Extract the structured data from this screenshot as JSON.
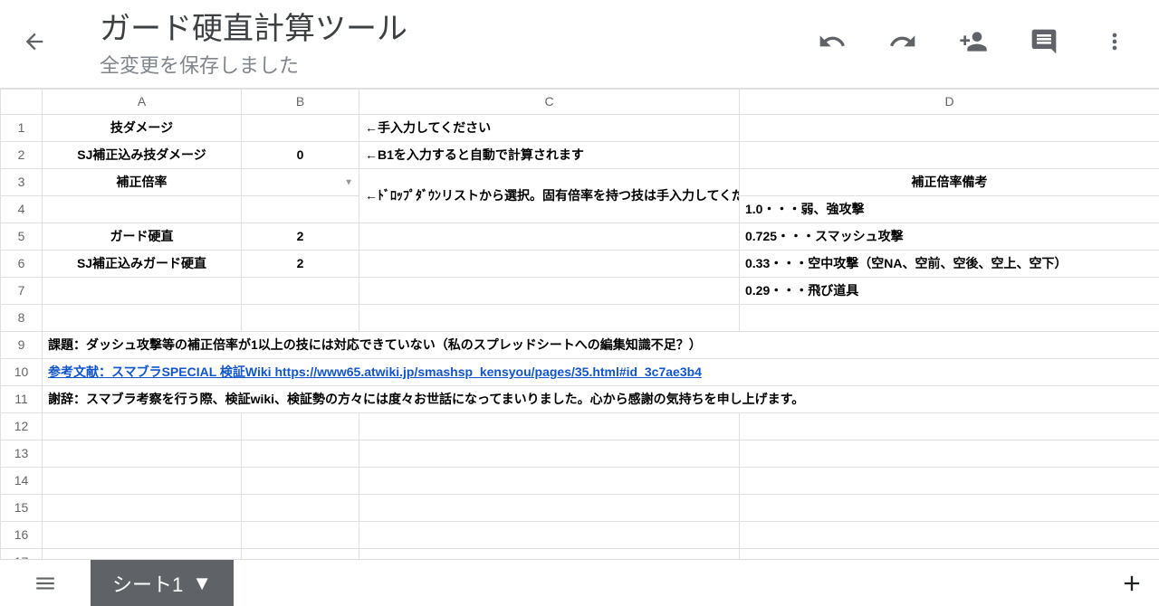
{
  "header": {
    "title": "ガード硬直計算ツール",
    "save_status": "全変更を保存しました"
  },
  "columns": [
    "A",
    "B",
    "C",
    "D"
  ],
  "cells": {
    "A1": "技ダメージ",
    "C1": "←手入力してください",
    "A2": "SJ補正込み技ダメージ",
    "B2": "0",
    "C2": "←B1を入力すると自動で計算されます",
    "A3": "補正倍率",
    "C3_4": "←ﾄﾞﾛｯﾌﾟﾀﾞｳﾝリストから選択。固有倍率を持つ技は手入力してください",
    "D3": "補正倍率備考",
    "D4": "1.0・・・弱、強攻撃",
    "A5": "ガード硬直",
    "B5": "2",
    "D5": "0.725・・・スマッシュ攻撃",
    "A6": "SJ補正込みガード硬直",
    "B6": "2",
    "D6": "0.33・・・空中攻撃（空NA、空前、空後、空上、空下）",
    "D7": "0.29・・・飛び道具",
    "A9": "課題：ダッシュ攻撃等の補正倍率が1以上の技には対応できていない（私のスプレッドシートへの編集知識不足？）",
    "A10": "参考文献：スマブラSPECIAL 検証Wiki  https://www65.atwiki.jp/smashsp_kensyou/pages/35.html#id_3c7ae3b4",
    "A11": "謝辞：スマブラ考察を行う際、検証wiki、検証勢の方々には度々お世話になってまいりました。心から感謝の気持ちを申し上げます。"
  },
  "footer": {
    "sheet_tab": "シート1"
  }
}
